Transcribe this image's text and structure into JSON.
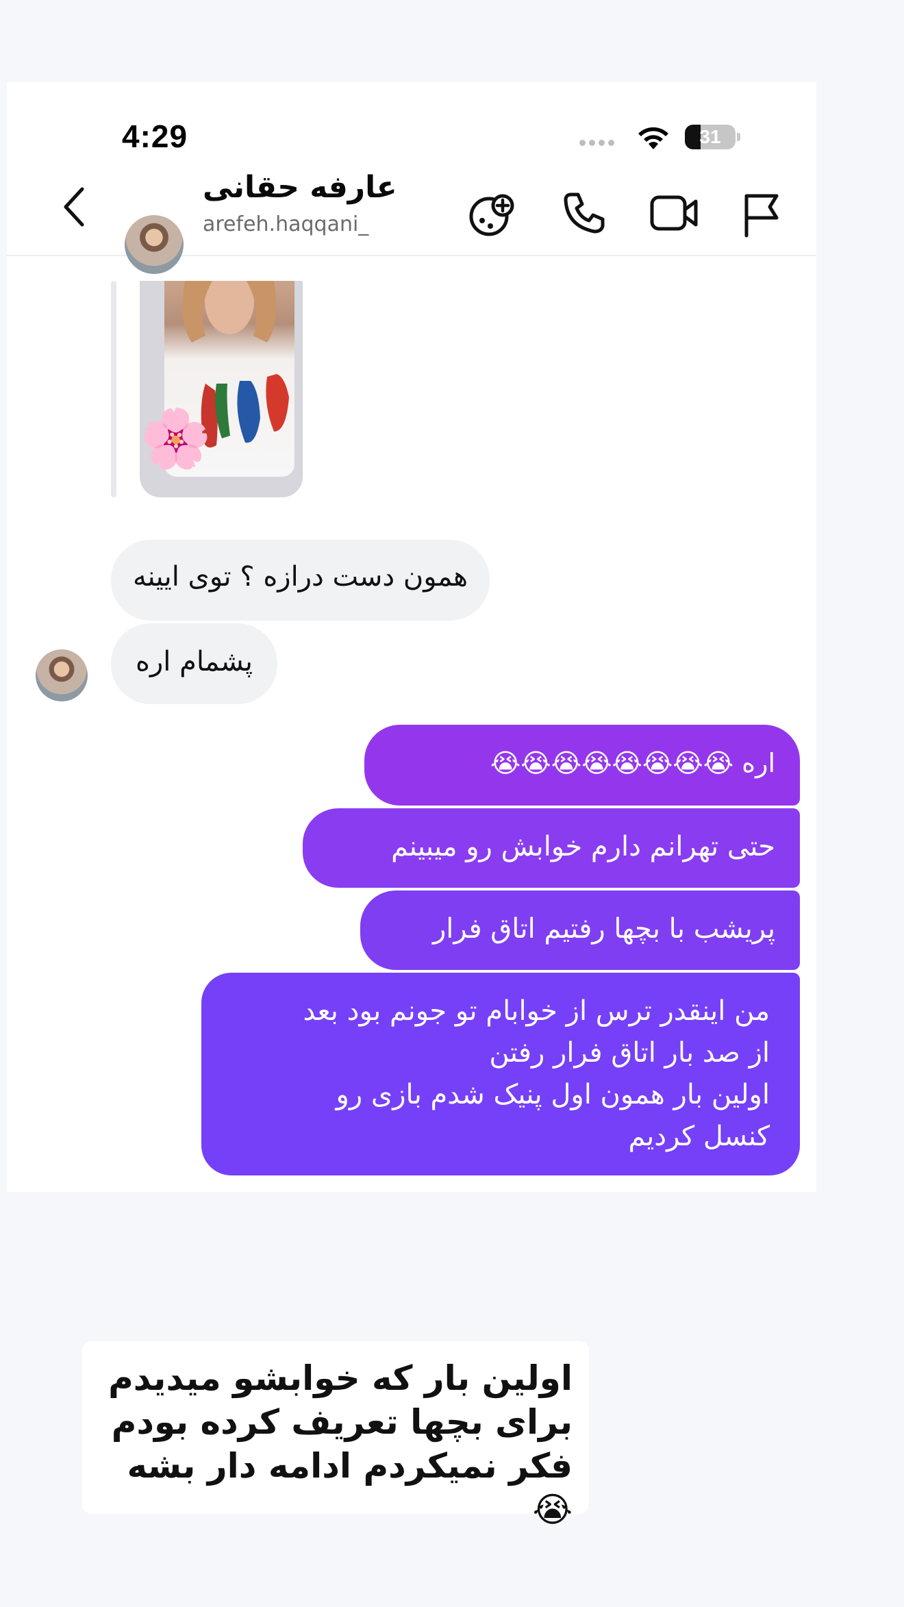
{
  "status_bar": {
    "time": "4:29",
    "battery": "31"
  },
  "header": {
    "name": "عارفه حقانی",
    "username": "arefeh.haqqani_",
    "icons": [
      "back-icon",
      "games-icon",
      "phone-icon",
      "video-icon",
      "flag-icon"
    ]
  },
  "messages": {
    "in_1": "همون دست درازه ؟ توی ایینه",
    "in_2": "پشمام اره",
    "out_1": "اره 😭😭😭😭😭😭😭😭",
    "out_2": "حتی تهرانم دارم خوابش رو میبینم",
    "out_3": "پریشب با بچها رفتیم اتاق فرار",
    "out_4": "من اینقدر ترس از خوابام تو جونم بود بعد\nاز صد بار اتاق فرار رفتن\nاولین بار همون اول پنیک شدم بازی رو\nکنسل کردیم"
  },
  "story_caption": "اولین بار که خوابشو میدیدم\nبرای بچها تعریف کرده بودم\nفکر نمیکردم ادامه دار بشه😭",
  "colors": {
    "incoming": "#f1f2f4",
    "out_1": "#9437ec",
    "out_2": "#8a3cf0",
    "out_3": "#7f3ef2",
    "out_4": "#7540f7"
  }
}
